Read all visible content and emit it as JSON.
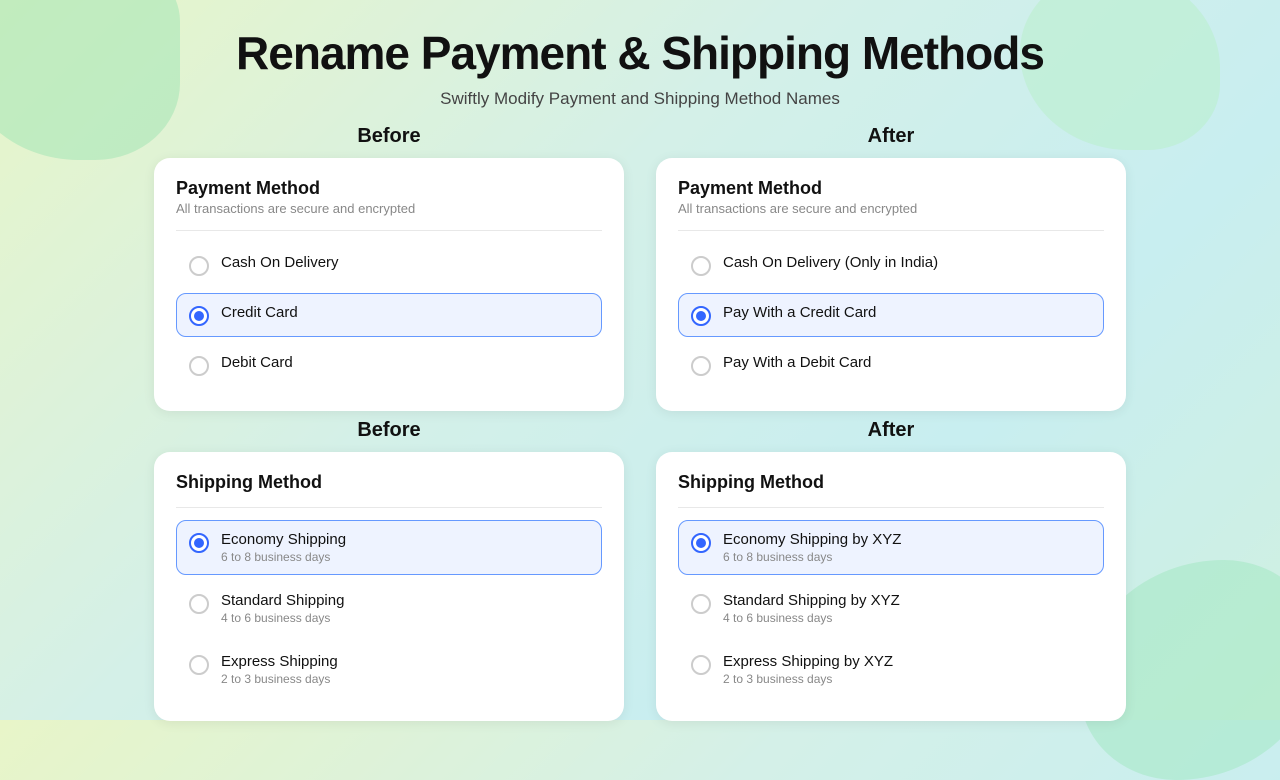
{
  "page": {
    "title": "Rename Payment & Shipping Methods",
    "subtitle": "Swiftly Modify Payment and Shipping Method Names"
  },
  "payment_before": {
    "section_label": "Before",
    "card_title": "Payment Method",
    "card_subtitle": "All transactions are secure and encrypted",
    "options": [
      {
        "name": "Cash On Delivery",
        "selected": false
      },
      {
        "name": "Credit Card",
        "selected": true
      },
      {
        "name": "Debit Card",
        "selected": false
      }
    ]
  },
  "payment_after": {
    "section_label": "After",
    "card_title": "Payment Method",
    "card_subtitle": "All transactions are secure and encrypted",
    "options": [
      {
        "name": "Cash On Delivery (Only in India)",
        "selected": false
      },
      {
        "name": "Pay With a Credit Card",
        "selected": true
      },
      {
        "name": "Pay With a Debit Card",
        "selected": false
      }
    ]
  },
  "shipping_before": {
    "section_label": "Before",
    "card_title": "Shipping Method",
    "options": [
      {
        "name": "Economy Shipping",
        "sub": "6 to 8 business days",
        "selected": true
      },
      {
        "name": "Standard Shipping",
        "sub": "4 to 6 business days",
        "selected": false
      },
      {
        "name": "Express Shipping",
        "sub": "2 to 3 business days",
        "selected": false
      }
    ]
  },
  "shipping_after": {
    "section_label": "After",
    "card_title": "Shipping Method",
    "options": [
      {
        "name": "Economy Shipping by XYZ",
        "sub": "6 to 8 business days",
        "selected": true
      },
      {
        "name": "Standard Shipping by XYZ",
        "sub": "4 to 6 business days",
        "selected": false
      },
      {
        "name": "Express Shipping by XYZ",
        "sub": "2 to 3 business days",
        "selected": false
      }
    ]
  }
}
